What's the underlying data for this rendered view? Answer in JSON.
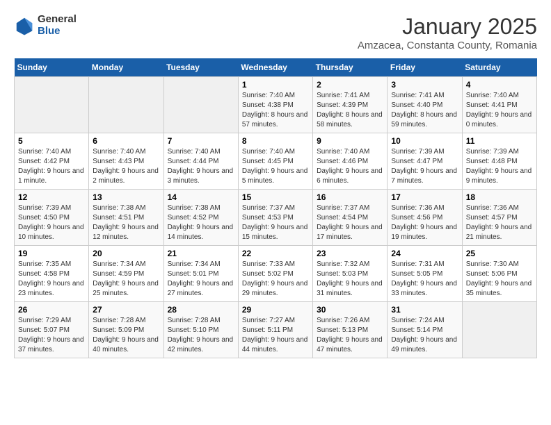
{
  "header": {
    "logo_general": "General",
    "logo_blue": "Blue",
    "title": "January 2025",
    "subtitle": "Amzacea, Constanta County, Romania"
  },
  "weekdays": [
    "Sunday",
    "Monday",
    "Tuesday",
    "Wednesday",
    "Thursday",
    "Friday",
    "Saturday"
  ],
  "weeks": [
    [
      {
        "day": "",
        "info": ""
      },
      {
        "day": "",
        "info": ""
      },
      {
        "day": "",
        "info": ""
      },
      {
        "day": "1",
        "info": "Sunrise: 7:40 AM\nSunset: 4:38 PM\nDaylight: 8 hours and 57 minutes."
      },
      {
        "day": "2",
        "info": "Sunrise: 7:41 AM\nSunset: 4:39 PM\nDaylight: 8 hours and 58 minutes."
      },
      {
        "day": "3",
        "info": "Sunrise: 7:41 AM\nSunset: 4:40 PM\nDaylight: 8 hours and 59 minutes."
      },
      {
        "day": "4",
        "info": "Sunrise: 7:40 AM\nSunset: 4:41 PM\nDaylight: 9 hours and 0 minutes."
      }
    ],
    [
      {
        "day": "5",
        "info": "Sunrise: 7:40 AM\nSunset: 4:42 PM\nDaylight: 9 hours and 1 minute."
      },
      {
        "day": "6",
        "info": "Sunrise: 7:40 AM\nSunset: 4:43 PM\nDaylight: 9 hours and 2 minutes."
      },
      {
        "day": "7",
        "info": "Sunrise: 7:40 AM\nSunset: 4:44 PM\nDaylight: 9 hours and 3 minutes."
      },
      {
        "day": "8",
        "info": "Sunrise: 7:40 AM\nSunset: 4:45 PM\nDaylight: 9 hours and 5 minutes."
      },
      {
        "day": "9",
        "info": "Sunrise: 7:40 AM\nSunset: 4:46 PM\nDaylight: 9 hours and 6 minutes."
      },
      {
        "day": "10",
        "info": "Sunrise: 7:39 AM\nSunset: 4:47 PM\nDaylight: 9 hours and 7 minutes."
      },
      {
        "day": "11",
        "info": "Sunrise: 7:39 AM\nSunset: 4:48 PM\nDaylight: 9 hours and 9 minutes."
      }
    ],
    [
      {
        "day": "12",
        "info": "Sunrise: 7:39 AM\nSunset: 4:50 PM\nDaylight: 9 hours and 10 minutes."
      },
      {
        "day": "13",
        "info": "Sunrise: 7:38 AM\nSunset: 4:51 PM\nDaylight: 9 hours and 12 minutes."
      },
      {
        "day": "14",
        "info": "Sunrise: 7:38 AM\nSunset: 4:52 PM\nDaylight: 9 hours and 14 minutes."
      },
      {
        "day": "15",
        "info": "Sunrise: 7:37 AM\nSunset: 4:53 PM\nDaylight: 9 hours and 15 minutes."
      },
      {
        "day": "16",
        "info": "Sunrise: 7:37 AM\nSunset: 4:54 PM\nDaylight: 9 hours and 17 minutes."
      },
      {
        "day": "17",
        "info": "Sunrise: 7:36 AM\nSunset: 4:56 PM\nDaylight: 9 hours and 19 minutes."
      },
      {
        "day": "18",
        "info": "Sunrise: 7:36 AM\nSunset: 4:57 PM\nDaylight: 9 hours and 21 minutes."
      }
    ],
    [
      {
        "day": "19",
        "info": "Sunrise: 7:35 AM\nSunset: 4:58 PM\nDaylight: 9 hours and 23 minutes."
      },
      {
        "day": "20",
        "info": "Sunrise: 7:34 AM\nSunset: 4:59 PM\nDaylight: 9 hours and 25 minutes."
      },
      {
        "day": "21",
        "info": "Sunrise: 7:34 AM\nSunset: 5:01 PM\nDaylight: 9 hours and 27 minutes."
      },
      {
        "day": "22",
        "info": "Sunrise: 7:33 AM\nSunset: 5:02 PM\nDaylight: 9 hours and 29 minutes."
      },
      {
        "day": "23",
        "info": "Sunrise: 7:32 AM\nSunset: 5:03 PM\nDaylight: 9 hours and 31 minutes."
      },
      {
        "day": "24",
        "info": "Sunrise: 7:31 AM\nSunset: 5:05 PM\nDaylight: 9 hours and 33 minutes."
      },
      {
        "day": "25",
        "info": "Sunrise: 7:30 AM\nSunset: 5:06 PM\nDaylight: 9 hours and 35 minutes."
      }
    ],
    [
      {
        "day": "26",
        "info": "Sunrise: 7:29 AM\nSunset: 5:07 PM\nDaylight: 9 hours and 37 minutes."
      },
      {
        "day": "27",
        "info": "Sunrise: 7:28 AM\nSunset: 5:09 PM\nDaylight: 9 hours and 40 minutes."
      },
      {
        "day": "28",
        "info": "Sunrise: 7:28 AM\nSunset: 5:10 PM\nDaylight: 9 hours and 42 minutes."
      },
      {
        "day": "29",
        "info": "Sunrise: 7:27 AM\nSunset: 5:11 PM\nDaylight: 9 hours and 44 minutes."
      },
      {
        "day": "30",
        "info": "Sunrise: 7:26 AM\nSunset: 5:13 PM\nDaylight: 9 hours and 47 minutes."
      },
      {
        "day": "31",
        "info": "Sunrise: 7:24 AM\nSunset: 5:14 PM\nDaylight: 9 hours and 49 minutes."
      },
      {
        "day": "",
        "info": ""
      }
    ]
  ]
}
